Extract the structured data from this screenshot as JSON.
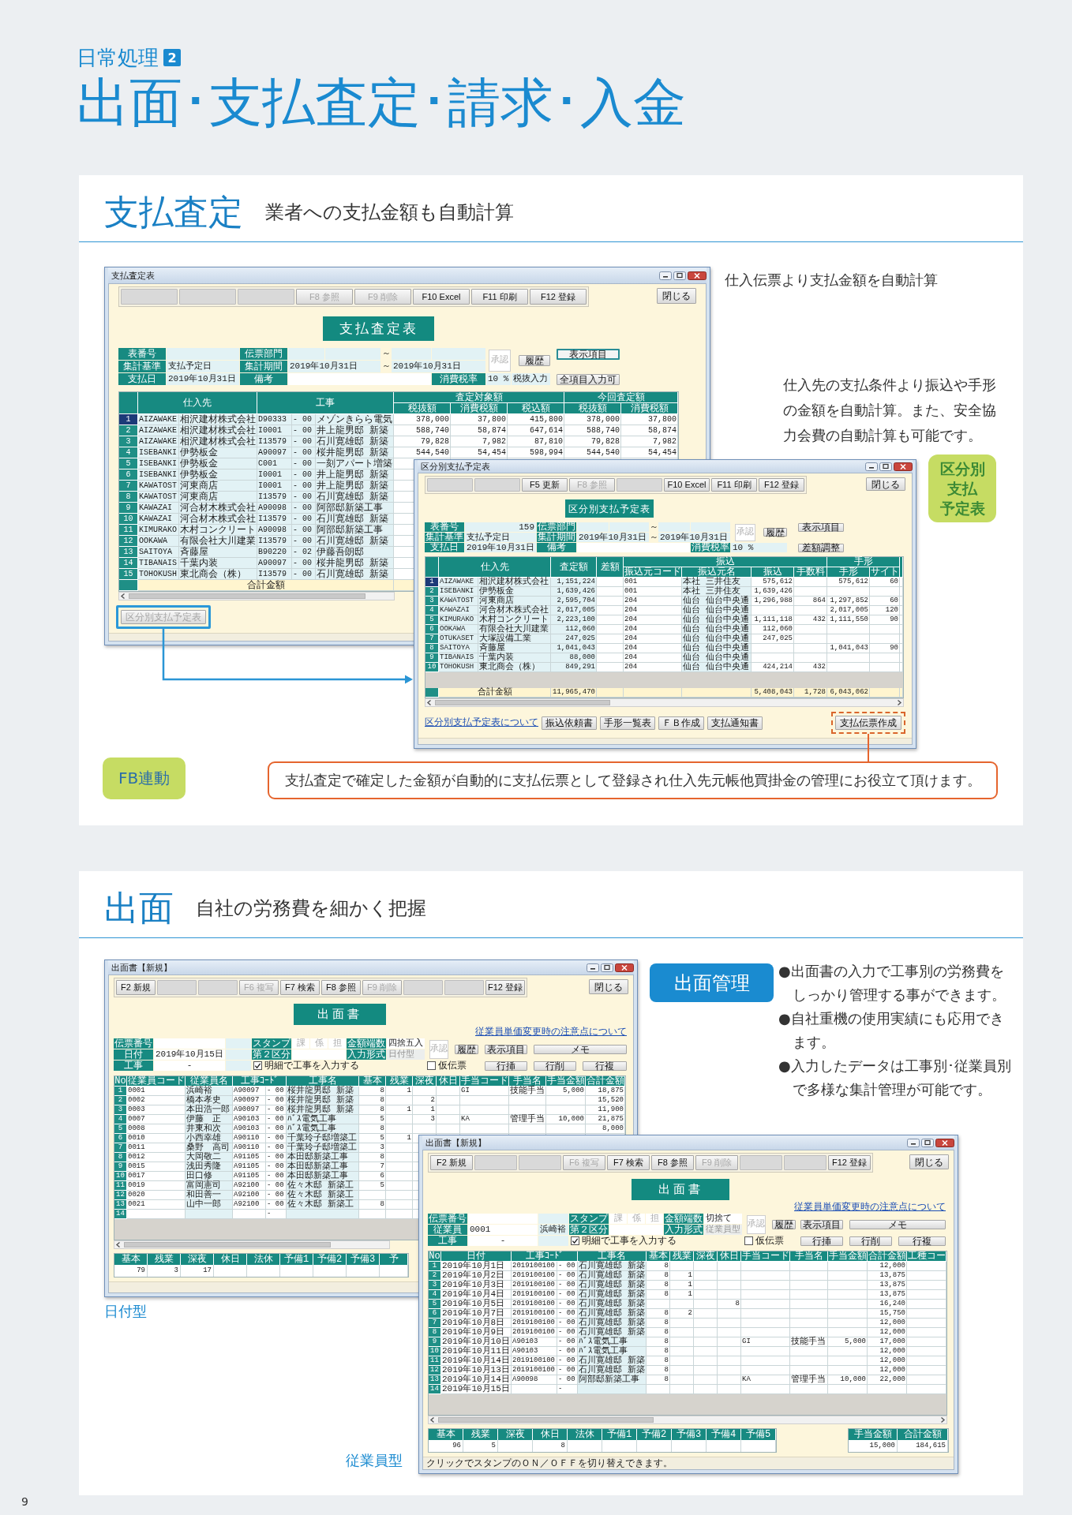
{
  "page_header": {
    "category": "日常処理",
    "number": "2",
    "title": "出面･支払査定･請求･入金"
  },
  "sections": [
    {
      "kind": "payment",
      "title": "支払査定",
      "subtitle": "業者への支払金額も自動計算",
      "caption": "仕入伝票より支払金額を自動計算",
      "description": "仕入先の支払条件より振込や手形の金額を自動計算。また、安全協力会費の自動計算も可能です。",
      "badge_lines": [
        "区分別",
        "支払",
        "予定表"
      ],
      "fb_badge": "FB連動",
      "callout": "支払査定で確定した金額が自動的に支払伝票として登録され仕入先元帳他買掛金の管理にお役立て頂けます。",
      "windows": [
        {
          "title": "支払査定表",
          "toolbar": [
            {
              "kind": "blank"
            },
            {
              "kind": "blank"
            },
            {
              "kind": "blank"
            },
            {
              "kind": "key",
              "label": "F8 参照",
              "disabled": true
            },
            {
              "kind": "key",
              "label": "F9 削除",
              "disabled": true
            },
            {
              "kind": "key",
              "label": "F10 Excel",
              "disabled": false
            },
            {
              "kind": "key",
              "label": "F11 印刷",
              "disabled": false
            },
            {
              "kind": "key",
              "label": "F12 登録",
              "disabled": false
            }
          ],
          "close_button": "閉じる",
          "heading": "支払査定表",
          "form": [
            {
              "kind": "label",
              "text": "表番号"
            },
            {
              "kind": "value"
            },
            {
              "kind": "label",
              "text": "伝票部門"
            },
            {
              "kind": "value"
            },
            {
              "kind": "value"
            },
            {
              "kind": "sep",
              "text": "～"
            },
            {
              "kind": "value"
            },
            {
              "kind": "value"
            },
            {
              "kind": "approval",
              "text": "承認"
            },
            {
              "kind": "button",
              "text": "履歴",
              "highlighted": false
            },
            {
              "kind": "button",
              "text": "表示項目",
              "highlighted": true
            },
            {
              "kind": "label",
              "text": "集計基準"
            },
            {
              "kind": "value",
              "text": "支払予定日"
            },
            {
              "kind": "label",
              "text": "集計期間"
            },
            {
              "kind": "value",
              "text": "2019年10月31日"
            },
            {
              "kind": "sep",
              "text": "～"
            },
            {
              "kind": "value",
              "text": "2019年10月31日"
            },
            {
              "kind": "label",
              "text": "支払日"
            },
            {
              "kind": "value",
              "text": "2019年10月31日"
            },
            {
              "kind": "label",
              "text": "備考"
            },
            {
              "kind": "value"
            },
            {
              "kind": "label",
              "text": "消費税率"
            },
            {
              "kind": "value",
              "text": "10 %"
            },
            {
              "kind": "value",
              "text": "税抜入力"
            },
            {
              "kind": "button",
              "text": "全項目入力可",
              "highlighted": false
            }
          ],
          "table": {
            "header": [
              {
                "label": "仕入先"
              },
              {
                "label": "工事"
              },
              {
                "label": "査定対象額",
                "columns": [
                  "税抜額",
                  "消費税額",
                  "税込額"
                ]
              },
              {
                "label": "今回査定額",
                "columns": [
                  "税抜額",
                  "消費税額"
                ]
              }
            ],
            "rows": [
              {
                "no": "1",
                "selected": true,
                "cells": [
                  "AIZAWAKE",
                  "相沢建材株式会社",
                  "D90333",
                  "- 00",
                  "メゾンきらら電気",
                  "378,000",
                  "37,800",
                  "415,800",
                  "378,000",
                  "37,800"
                ]
              },
              {
                "no": "2",
                "selected": false,
                "cells": [
                  "AIZAWAKE",
                  "相沢建材株式会社",
                  "I0001",
                  "- 00",
                  "井上龍男邸 新築",
                  "588,740",
                  "58,874",
                  "647,614",
                  "588,740",
                  "58,874"
                ]
              },
              {
                "no": "3",
                "selected": false,
                "cells": [
                  "AIZAWAKE",
                  "相沢建材株式会社",
                  "I13579",
                  "- 00",
                  "石川寛雄邸 新築",
                  "79,828",
                  "7,982",
                  "87,810",
                  "79,828",
                  "7,982"
                ]
              },
              {
                "no": "4",
                "selected": false,
                "cells": [
                  "ISEBANKI",
                  "伊勢板金",
                  "A90097",
                  "- 00",
                  "桜井龍男邸 新築",
                  "544,540",
                  "54,454",
                  "598,994",
                  "544,540",
                  "54,454"
                ]
              },
              {
                "no": "5",
                "selected": false,
                "cells": [
                  "ISEBANKI",
                  "伊勢板金",
                  "C001",
                  "- 00",
                  "一刻アパート増築"
                ]
              },
              {
                "no": "6",
                "selected": false,
                "cells": [
                  "ISEBANKI",
                  "伊勢板金",
                  "I0001",
                  "- 00",
                  "井上龍男邸 新築"
                ]
              },
              {
                "no": "7",
                "selected": false,
                "cells": [
                  "KAWATOST",
                  "河東商店",
                  "I0001",
                  "- 00",
                  "井上龍男邸 新築"
                ]
              },
              {
                "no": "8",
                "selected": false,
                "cells": [
                  "KAWATOST",
                  "河東商店",
                  "I13579",
                  "- 00",
                  "石川寛雄邸 新築"
                ]
              },
              {
                "no": "9",
                "selected": false,
                "cells": [
                  "KAWAZAI",
                  "河合材木株式会社",
                  "A90098",
                  "- 00",
                  "阿部邸新築工事"
                ]
              },
              {
                "no": "10",
                "selected": false,
                "cells": [
                  "KAWAZAI",
                  "河合材木株式会社",
                  "I13579",
                  "- 00",
                  "石川寛雄邸 新築"
                ]
              },
              {
                "no": "11",
                "selected": false,
                "cells": [
                  "KIMURAKO",
                  "木村コンクリート",
                  "A90098",
                  "- 00",
                  "阿部邸新築工事"
                ]
              },
              {
                "no": "12",
                "selected": false,
                "cells": [
                  "OOKAWA",
                  "有限会社大川建業",
                  "I13579",
                  "- 00",
                  "石川寛雄邸 新築"
                ]
              },
              {
                "no": "13",
                "selected": false,
                "cells": [
                  "SAITOYA",
                  "斉藤屋",
                  "B90220",
                  "- 02",
                  "伊藤吾朗邸"
                ]
              },
              {
                "no": "14",
                "selected": false,
                "cells": [
                  "TIBANAIS",
                  "千葉内装",
                  "A90097",
                  "- 00",
                  "桜井龍男邸 新築"
                ]
              },
              {
                "no": "15",
                "selected": false,
                "cells": [
                  "TOHOKUSH",
                  "東北商会（株）",
                  "I13579",
                  "- 00",
                  "石川寛雄邸 新築"
                ]
              }
            ],
            "total": {
              "label": "合計金額"
            }
          },
          "footer": {
            "action": {
              "label": "区分別支払予定表",
              "disabled": true,
              "framed": true
            }
          }
        },
        {
          "title": "区分別支払予定表",
          "toolbar": [
            {
              "kind": "blank"
            },
            {
              "kind": "blank"
            },
            {
              "kind": "key",
              "label": "F5 更新",
              "disabled": false
            },
            {
              "kind": "key",
              "label": "F8 参照",
              "disabled": true
            },
            {
              "kind": "blank"
            },
            {
              "kind": "key",
              "label": "F10 Excel",
              "disabled": false
            },
            {
              "kind": "key",
              "label": "F11 印刷",
              "disabled": false
            },
            {
              "kind": "key",
              "label": "F12 登録",
              "disabled": false
            }
          ],
          "close_button": "閉じる",
          "heading": "区分別支払予定表",
          "form": [
            {
              "kind": "label",
              "text": "表番号"
            },
            {
              "kind": "value",
              "text": "159"
            },
            {
              "kind": "label",
              "text": "伝票部門"
            },
            {
              "kind": "value"
            },
            {
              "kind": "value"
            },
            {
              "kind": "sep",
              "text": "～"
            },
            {
              "kind": "value"
            },
            {
              "kind": "value"
            },
            {
              "kind": "approval",
              "text": "承認"
            },
            {
              "kind": "button",
              "text": "履歴",
              "highlighted": false
            },
            {
              "kind": "button",
              "text": "表示項目",
              "highlighted": false
            },
            {
              "kind": "label",
              "text": "集計基準"
            },
            {
              "kind": "value",
              "text": "支払予定日"
            },
            {
              "kind": "label",
              "text": "集計期間"
            },
            {
              "kind": "value",
              "text": "2019年10月31日"
            },
            {
              "kind": "sep",
              "text": "～"
            },
            {
              "kind": "value",
              "text": "2019年10月31日"
            },
            {
              "kind": "label",
              "text": "支払日"
            },
            {
              "kind": "value",
              "text": "2019年10月31日"
            },
            {
              "kind": "label",
              "text": "備考"
            },
            {
              "kind": "value"
            },
            {
              "kind": "label",
              "text": "消費税率"
            },
            {
              "kind": "value",
              "text": "10 %"
            },
            {
              "kind": "button",
              "text": "差額調整",
              "highlighted": false
            }
          ],
          "table": {
            "header": [
              {
                "label": "仕入先"
              },
              {
                "label": "査定額"
              },
              {
                "label": "差額"
              },
              {
                "label": "振込",
                "columns": [
                  "振込元コード",
                  "振込元名",
                  "振込",
                  "手数料"
                ]
              },
              {
                "label": "手形",
                "columns": [
                  "手形",
                  "サイト"
                ]
              }
            ],
            "rows": [
              {
                "no": "1",
                "selected": true,
                "cells": [
                  "AIZAWAKE",
                  "相沢建材株式会社",
                  "1,151,224",
                  null,
                  "001",
                  "本社 三井住友",
                  "575,612",
                  null,
                  "575,612",
                  "60"
                ]
              },
              {
                "no": "2",
                "selected": false,
                "cells": [
                  "ISEBANKI",
                  "伊勢板金",
                  "1,639,426",
                  null,
                  "001",
                  "本社 三井住友",
                  "1,639,426"
                ]
              },
              {
                "no": "3",
                "selected": false,
                "cells": [
                  "KAWATOST",
                  "河東商店",
                  "2,595,704",
                  null,
                  "204",
                  "仙台 仙台中央通",
                  "1,296,988",
                  "864",
                  "1,297,852",
                  "60"
                ]
              },
              {
                "no": "4",
                "selected": false,
                "cells": [
                  "KAWAZAI",
                  "河合材木株式会社",
                  "2,017,005",
                  null,
                  "204",
                  "仙台 仙台中央通",
                  null,
                  null,
                  "2,017,005",
                  "120"
                ]
              },
              {
                "no": "5",
                "selected": false,
                "cells": [
                  "KIMURAKO",
                  "木村コンクリート",
                  "2,223,100",
                  null,
                  "204",
                  "仙台 仙台中央通",
                  "1,111,118",
                  "432",
                  "1,111,550",
                  "90"
                ]
              },
              {
                "no": "6",
                "selected": false,
                "cells": [
                  "OOKAWA",
                  "有限会社大川建業",
                  "112,060",
                  null,
                  "204",
                  "仙台 仙台中央通",
                  "112,060"
                ]
              },
              {
                "no": "7",
                "selected": false,
                "cells": [
                  "OTUKASET",
                  "大塚設備工業",
                  "247,025",
                  null,
                  "204",
                  "仙台 仙台中央通",
                  "247,025"
                ]
              },
              {
                "no": "8",
                "selected": false,
                "cells": [
                  "SAITOYA",
                  "斉藤屋",
                  "1,041,043",
                  null,
                  "204",
                  "仙台 仙台中央通",
                  null,
                  null,
                  "1,041,043",
                  "90"
                ]
              },
              {
                "no": "9",
                "selected": false,
                "cells": [
                  "TIBANAIS",
                  "千葉内装",
                  "88,000",
                  null,
                  "204",
                  "仙台 仙台中央通"
                ]
              },
              {
                "no": "10",
                "selected": false,
                "cells": [
                  "TOHOKUSH",
                  "東北商会（株）",
                  "849,291",
                  null,
                  "204",
                  "仙台 仙台中央通",
                  "424,214",
                  "432"
                ]
              }
            ],
            "total": {
              "label": "合計金額",
              "cells": [
                "11,965,470",
                null,
                null,
                null,
                "5,408,043",
                "1,728",
                "6,043,062"
              ]
            }
          },
          "footer": {
            "link": "区分別支払予定表について",
            "buttons": [
              "振込依頼書",
              "手形一覧表",
              "ＦＢ作成",
              "支払通知書"
            ],
            "action": {
              "label": "支払伝票作成",
              "disabled": false,
              "framed": true
            }
          }
        }
      ]
    },
    {
      "kind": "attendance",
      "title": "出面",
      "subtitle": "自社の労務費を細かく把握",
      "badge": "出面管理",
      "bullets": [
        "●出面書の入力で工事別の労務費をしっかり管理する事ができます。",
        "●自社重機の使用実績にも応用できます。",
        "●入力したデータは工事別･従業員別で多様な集計管理が可能です。"
      ],
      "window_captions": [
        "日付型",
        "従業員型"
      ],
      "windows": [
        {
          "title": "出面書【新規】",
          "toolbar": [
            {
              "kind": "key",
              "label": "F2 新規",
              "disabled": false
            },
            {
              "kind": "blank"
            },
            {
              "kind": "blank"
            },
            {
              "kind": "key",
              "label": "F6 複写",
              "disabled": true
            },
            {
              "kind": "key",
              "label": "F7 検索",
              "disabled": false
            },
            {
              "kind": "key",
              "label": "F8 参照",
              "disabled": false
            },
            {
              "kind": "key",
              "label": "F9 削除",
              "disabled": true
            },
            {
              "kind": "blank"
            },
            {
              "kind": "blank"
            },
            {
              "kind": "key",
              "label": "F12 登録",
              "disabled": false
            }
          ],
          "close_button": "閉じる",
          "heading": "出面書",
          "form": [
            {
              "kind": "label",
              "text": "伝票番号"
            },
            {
              "kind": "value"
            },
            {
              "kind": "value"
            },
            {
              "kind": "label",
              "text": "スタンプ"
            },
            {
              "kind": "stamp",
              "text": "課"
            },
            {
              "kind": "stamp",
              "text": "係"
            },
            {
              "kind": "stamp",
              "text": "担"
            },
            {
              "kind": "label",
              "text": "金額端数"
            },
            {
              "kind": "value",
              "text": "四捨五入"
            },
            {
              "kind": "approval",
              "text": "承認"
            },
            {
              "kind": "button",
              "text": "履歴"
            },
            {
              "kind": "link",
              "text": "従業員単価変更時の注意点について"
            },
            {
              "kind": "label",
              "text": "日付"
            },
            {
              "kind": "value",
              "text": "2019年10月15日"
            },
            {
              "kind": "value"
            },
            {
              "kind": "label",
              "text": "第２区分"
            },
            {
              "kind": "value"
            },
            {
              "kind": "label",
              "text": "入力形式"
            },
            {
              "kind": "readonly",
              "text": "日付型"
            },
            {
              "kind": "button",
              "text": "表示項目"
            },
            {
              "kind": "button",
              "text": "メモ"
            },
            {
              "kind": "label",
              "text": "工事"
            },
            {
              "kind": "value",
              "text": "-"
            },
            {
              "kind": "value"
            },
            {
              "kind": "check",
              "text": "明細で工事を入力する",
              "checked": true
            },
            {
              "kind": "check",
              "text": "仮伝票",
              "checked": false
            },
            {
              "kind": "button",
              "text": "行挿"
            },
            {
              "kind": "button",
              "text": "行削"
            },
            {
              "kind": "button",
              "text": "行複"
            }
          ],
          "table": {
            "no_header": "No",
            "header": [
              {
                "label": "従業員コード"
              },
              {
                "label": "従業員名"
              },
              {
                "label": "工事ｺｰﾄﾞ"
              },
              {
                "label": "工事名"
              },
              {
                "label": "基本"
              },
              {
                "label": "残業"
              },
              {
                "label": "深夜"
              },
              {
                "label": "休日"
              },
              {
                "label": "手当コード"
              },
              {
                "label": "手当名"
              },
              {
                "label": "手当金額"
              },
              {
                "label": "合計金額"
              }
            ],
            "rows": [
              {
                "no": "1",
                "cells": [
                  "0001",
                  "浜崎裕",
                  "A90097",
                  "- 00",
                  "桜井龍男邸 新築",
                  "8",
                  "1",
                  null,
                  null,
                  "GI",
                  "技能手当",
                  "5,000",
                  "18,875"
                ]
              },
              {
                "no": "2",
                "cells": [
                  "0002",
                  "橋本孝史",
                  "A90097",
                  "- 00",
                  "桜井龍男邸 新築",
                  "8",
                  null,
                  "2",
                  null,
                  null,
                  null,
                  null,
                  "15,520"
                ]
              },
              {
                "no": "3",
                "cells": [
                  "0003",
                  "本田浩一郎",
                  "A90097",
                  "- 00",
                  "桜井龍男邸 新築",
                  "8",
                  "1",
                  "1",
                  null,
                  null,
                  null,
                  null,
                  "11,900"
                ]
              },
              {
                "no": "4",
                "cells": [
                  "0007",
                  "伊藤　正",
                  "A90103",
                  "- 00",
                  "ﾊﾞｽ電気工事",
                  "5",
                  null,
                  "3",
                  null,
                  "KA",
                  "管理手当",
                  "10,000",
                  "21,875"
                ]
              },
              {
                "no": "5",
                "cells": [
                  "0008",
                  "井東和次",
                  "A90103",
                  "- 00",
                  "ﾊﾞｽ電気工事",
                  "8",
                  null,
                  null,
                  null,
                  null,
                  null,
                  null,
                  "8,000"
                ]
              },
              {
                "no": "6",
                "cells": [
                  "0010",
                  "小西幸雄",
                  "A90110",
                  "- 00",
                  "千葉玲子邸増築工",
                  "5",
                  "1"
                ]
              },
              {
                "no": "7",
                "cells": [
                  "0011",
                  "桑野　高司",
                  "A90110",
                  "- 00",
                  "千葉玲子邸増築工",
                  "3"
                ]
              },
              {
                "no": "8",
                "cells": [
                  "0012",
                  "大岡敬二",
                  "A91105",
                  "- 00",
                  "本田邸新築工事",
                  "8"
                ]
              },
              {
                "no": "9",
                "cells": [
                  "0015",
                  "浅田秀隆",
                  "A91105",
                  "- 00",
                  "本田邸新築工事",
                  "7"
                ]
              },
              {
                "no": "10",
                "cells": [
                  "0017",
                  "田口修",
                  "A91105",
                  "- 00",
                  "本田邸新築工事",
                  "6"
                ]
              },
              {
                "no": "11",
                "cells": [
                  "0019",
                  "富岡憲司",
                  "A92100",
                  "- 00",
                  "佐々木邸 新築工",
                  "5"
                ]
              },
              {
                "no": "12",
                "cells": [
                  "0020",
                  "和田善一",
                  "A92100",
                  "- 00",
                  "佐々木邸 新築工"
                ]
              },
              {
                "no": "13",
                "cells": [
                  "0021",
                  "山中一郎",
                  "A92100",
                  "- 00",
                  "佐々木邸 新築工",
                  "8"
                ]
              },
              {
                "no": "14",
                "cells": [
                  null,
                  null,
                  null,
                  "-"
                ]
              }
            ]
          },
          "footer": {
            "summary": [
              {
                "label": "基本",
                "value": "79"
              },
              {
                "label": "残業",
                "value": "3"
              },
              {
                "label": "深夜",
                "value": "17"
              },
              {
                "label": "休日"
              },
              {
                "label": "法休"
              },
              {
                "label": "予備1"
              },
              {
                "label": "予備2"
              },
              {
                "label": "予備3"
              },
              {
                "label": "予"
              }
            ]
          }
        },
        {
          "title": "出面書【新規】",
          "toolbar": [
            {
              "kind": "key",
              "label": "F2 新規",
              "disabled": false
            },
            {
              "kind": "blank"
            },
            {
              "kind": "blank"
            },
            {
              "kind": "key",
              "label": "F6 複写",
              "disabled": true
            },
            {
              "kind": "key",
              "label": "F7 検索",
              "disabled": false
            },
            {
              "kind": "key",
              "label": "F8 参照",
              "disabled": false
            },
            {
              "kind": "key",
              "label": "F9 削除",
              "disabled": true
            },
            {
              "kind": "blank"
            },
            {
              "kind": "blank"
            },
            {
              "kind": "key",
              "label": "F12 登録",
              "disabled": false
            }
          ],
          "close_button": "閉じる",
          "heading": "出面書",
          "form": [
            {
              "kind": "label",
              "text": "伝票番号"
            },
            {
              "kind": "value"
            },
            {
              "kind": "value"
            },
            {
              "kind": "label",
              "text": "スタンプ"
            },
            {
              "kind": "stamp",
              "text": "課"
            },
            {
              "kind": "stamp",
              "text": "係"
            },
            {
              "kind": "stamp",
              "text": "担"
            },
            {
              "kind": "label",
              "text": "金額端数"
            },
            {
              "kind": "value",
              "text": "切捨て"
            },
            {
              "kind": "approval",
              "text": "承認"
            },
            {
              "kind": "button",
              "text": "履歴"
            },
            {
              "kind": "link",
              "text": "従業員単価変更時の注意点について"
            },
            {
              "kind": "label",
              "text": "従業員"
            },
            {
              "kind": "value",
              "text": "0001"
            },
            {
              "kind": "value",
              "text": "浜崎裕"
            },
            {
              "kind": "label",
              "text": "第２区分"
            },
            {
              "kind": "value"
            },
            {
              "kind": "label",
              "text": "入力形式"
            },
            {
              "kind": "readonly",
              "text": "従業員型"
            },
            {
              "kind": "button",
              "text": "表示項目"
            },
            {
              "kind": "button",
              "text": "メモ"
            },
            {
              "kind": "label",
              "text": "工事"
            },
            {
              "kind": "value",
              "text": "-"
            },
            {
              "kind": "value"
            },
            {
              "kind": "check",
              "text": "明細で工事を入力する",
              "checked": true
            },
            {
              "kind": "check",
              "text": "仮伝票",
              "checked": false
            },
            {
              "kind": "button",
              "text": "行挿"
            },
            {
              "kind": "button",
              "text": "行削"
            },
            {
              "kind": "button",
              "text": "行複"
            }
          ],
          "table": {
            "no_header": "No",
            "header": [
              {
                "label": "日付"
              },
              {
                "label": "工事ｺｰﾄﾞ"
              },
              {
                "label": "工事名"
              },
              {
                "label": "基本"
              },
              {
                "label": "残業"
              },
              {
                "label": "深夜"
              },
              {
                "label": "休日"
              },
              {
                "label": "手当コード"
              },
              {
                "label": "手当名"
              },
              {
                "label": "手当金額"
              },
              {
                "label": "合計金額"
              },
              {
                "label": "工種コー"
              }
            ],
            "rows": [
              {
                "no": "1",
                "cells": [
                  "2019年10月1日",
                  "2019100100",
                  "- 00",
                  "石川寛雄邸 新築",
                  "8",
                  null,
                  null,
                  null,
                  null,
                  null,
                  null,
                  "12,000"
                ]
              },
              {
                "no": "2",
                "cells": [
                  "2019年10月2日",
                  "2019100100",
                  "- 00",
                  "石川寛雄邸 新築",
                  "8",
                  "1",
                  null,
                  null,
                  null,
                  null,
                  null,
                  "13,875"
                ]
              },
              {
                "no": "3",
                "cells": [
                  "2019年10月3日",
                  "2019100100",
                  "- 00",
                  "石川寛雄邸 新築",
                  "8",
                  "1",
                  null,
                  null,
                  null,
                  null,
                  null,
                  "13,875"
                ]
              },
              {
                "no": "4",
                "cells": [
                  "2019年10月4日",
                  "2019100100",
                  "- 00",
                  "石川寛雄邸 新築",
                  "8",
                  "1",
                  null,
                  null,
                  null,
                  null,
                  null,
                  "13,875"
                ]
              },
              {
                "no": "5",
                "cells": [
                  "2019年10月5日",
                  "2019100100",
                  "- 00",
                  "石川寛雄邸 新築",
                  null,
                  null,
                  null,
                  "8",
                  null,
                  null,
                  null,
                  "16,240"
                ]
              },
              {
                "no": "6",
                "cells": [
                  "2019年10月7日",
                  "2019100100",
                  "- 00",
                  "石川寛雄邸 新築",
                  "8",
                  "2",
                  null,
                  null,
                  null,
                  null,
                  null,
                  "15,750"
                ]
              },
              {
                "no": "7",
                "cells": [
                  "2019年10月8日",
                  "2019100100",
                  "- 00",
                  "石川寛雄邸 新築",
                  "8",
                  null,
                  null,
                  null,
                  null,
                  null,
                  null,
                  "12,000"
                ]
              },
              {
                "no": "8",
                "cells": [
                  "2019年10月9日",
                  "2019100100",
                  "- 00",
                  "石川寛雄邸 新築",
                  "8",
                  null,
                  null,
                  null,
                  null,
                  null,
                  null,
                  "12,000"
                ]
              },
              {
                "no": "9",
                "cells": [
                  "2019年10月10日",
                  "A90103",
                  "- 00",
                  "ﾊﾞｽ電気工事",
                  "8",
                  null,
                  null,
                  null,
                  "GI",
                  "技能手当",
                  "5,000",
                  "17,000"
                ]
              },
              {
                "no": "10",
                "cells": [
                  "2019年10月11日",
                  "A90103",
                  "- 00",
                  "ﾊﾞｽ電気工事",
                  "8",
                  null,
                  null,
                  null,
                  null,
                  null,
                  null,
                  "12,000"
                ]
              },
              {
                "no": "11",
                "cells": [
                  "2019年10月14日",
                  "2019100100",
                  "- 00",
                  "石川寛雄邸 新築",
                  "8",
                  null,
                  null,
                  null,
                  null,
                  null,
                  null,
                  "12,000"
                ]
              },
              {
                "no": "12",
                "cells": [
                  "2019年10月13日",
                  "2019100100",
                  "- 00",
                  "石川寛雄邸 新築",
                  "8",
                  null,
                  null,
                  null,
                  null,
                  null,
                  null,
                  "12,000"
                ]
              },
              {
                "no": "13",
                "cells": [
                  "2019年10月14日",
                  "A90098",
                  "- 00",
                  "阿部邸新築工事",
                  "8",
                  null,
                  null,
                  null,
                  "KA",
                  "管理手当",
                  "10,000",
                  "22,000"
                ]
              },
              {
                "no": "14",
                "cells": [
                  "2019年10月15日",
                  null,
                  "-"
                ]
              }
            ]
          },
          "footer": {
            "summary": [
              {
                "label": "基本",
                "value": "96"
              },
              {
                "label": "残業",
                "value": "5"
              },
              {
                "label": "深夜"
              },
              {
                "label": "休日",
                "value": "8"
              },
              {
                "label": "法休"
              },
              {
                "label": "予備1"
              },
              {
                "label": "予備2"
              },
              {
                "label": "予備3"
              },
              {
                "label": "予備4"
              },
              {
                "label": "予備5"
              }
            ],
            "totals": [
              {
                "label": "手当金額",
                "value": "15,000"
              },
              {
                "label": "合計金額",
                "value": "184,615"
              }
            ],
            "status": "クリックでスタンプのＯＮ／ＯＦＦを切り替えできます。"
          }
        }
      ]
    }
  ],
  "page_number": "9"
}
